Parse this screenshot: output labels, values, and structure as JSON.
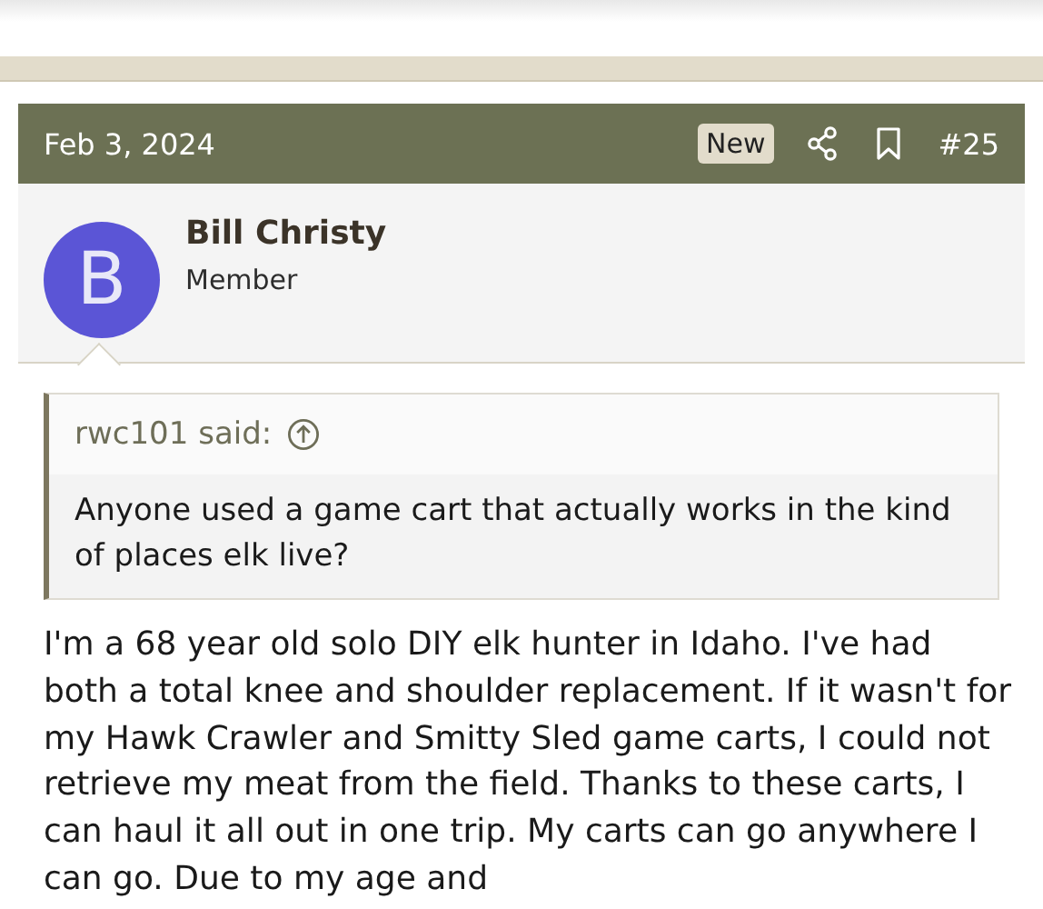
{
  "post": {
    "date": "Feb 3, 2024",
    "badge": "New",
    "number": "#25",
    "author": {
      "initial": "B",
      "name": "Bill Christy",
      "role": "Member"
    },
    "quote": {
      "attribution": "rwc101 said:",
      "text": "Anyone used a game cart that actually works in the kind of places elk live?"
    },
    "body": "I'm a 68 year old solo DIY elk hunter in Idaho. I've had both a total knee and shoulder replacement. If it wasn't for my Hawk Crawler and Smitty Sled game carts, I could not retrieve my meat from the field. Thanks to these carts, I can haul it all out in one trip. My carts can go anywhere I can go. Due to my age and"
  }
}
